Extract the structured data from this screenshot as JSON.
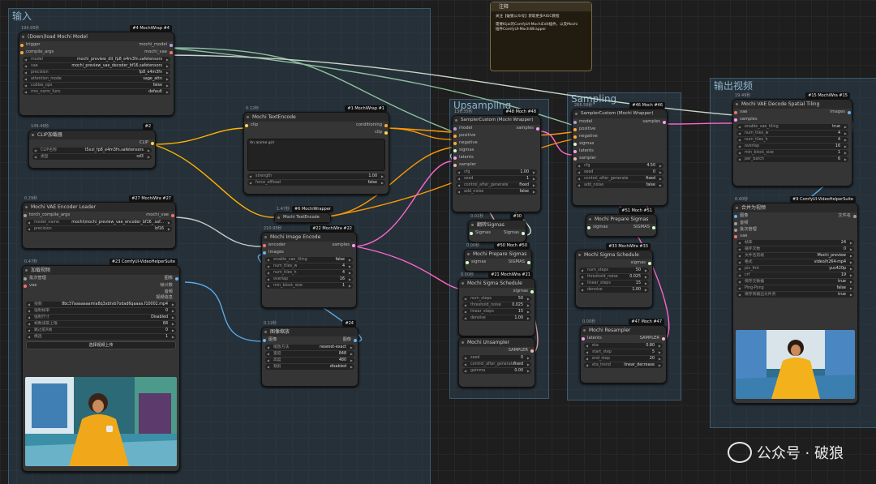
{
  "groups": {
    "input": "输入",
    "sampling1": "Upsampling",
    "sampling2": "Sampling",
    "output": "输出视频"
  },
  "note": {
    "title": "注释",
    "line1": "关注【破狼公众号】获取更多AIGC教程",
    "line2": "需要Kijai的ComfyUI-MochiEdit插件，以及Mochi",
    "line3": "插件ComfyUI-MochiWrapper"
  },
  "download_model": {
    "time": "194.95秒",
    "badge": "#4 MochiWrap  #4",
    "title": "(Down)load Mochi Model",
    "in1": "trigger",
    "in2": "compile_args",
    "out1": "mochi_model",
    "out2": "mochi_vae",
    "w": [
      {
        "k": "model",
        "v": "mochi_preview_dit_fp8_e4m3fn.safetensors"
      },
      {
        "k": "vae",
        "v": "mochi_preview_vae_decoder_bf16.safetensors"
      },
      {
        "k": "precision",
        "v": "fp8_e4m3fn"
      },
      {
        "k": "attention_mode",
        "v": "sage_attn"
      },
      {
        "k": "cublas_ops",
        "v": "false"
      },
      {
        "k": "rms_norm_func",
        "v": "default"
      }
    ]
  },
  "clip_loader": {
    "time": "149.46秒",
    "badge": "#2",
    "title": "CLIP加载器",
    "out1": "CLIP",
    "w": [
      {
        "k": "CLIP名称",
        "v": "t5xxl_fp8_e4m3fn.safetensors"
      },
      {
        "k": "类型",
        "v": "sd3"
      }
    ]
  },
  "text_encode": {
    "time": "0.12秒",
    "badge": "#1 MochiWrap  #1",
    "title": "Mochi TextEncode",
    "in1": "clip",
    "out1": "conditioning",
    "out2": "clip",
    "text": "An anime girl",
    "w": [
      {
        "k": "strength",
        "v": "1.00"
      },
      {
        "k": "force_offload",
        "v": "false"
      }
    ]
  },
  "vae_encoder_loader": {
    "time": "0.29秒",
    "badge": "#27 MochiWra  #27",
    "title": "Mochi VAE Encoder Loader",
    "in1": "torch_compile_args",
    "out1": "mochi_vae",
    "w": [
      {
        "k": "model_name",
        "v": "mochi\\mochi_preview_vae_encoder_bf16_.saf..."
      },
      {
        "k": "precision",
        "v": "bf16"
      }
    ]
  },
  "load_video": {
    "time": "0.47秒",
    "badge": "#23 ComfyUI-VideoHelperSuite",
    "title": "加载视频",
    "in1": "批次管理",
    "in2": "vae",
    "outs": [
      "图像",
      "帧计数",
      "音频",
      "视频信息"
    ],
    "w": [
      {
        "k": "视频",
        "v": "8bc37aaaaaaamia8q3xbtvb7odad6qaaaa.f10002.mp4"
      },
      {
        "k": "强制帧率",
        "v": "0"
      },
      {
        "k": "强制尺寸",
        "v": "Disabled"
      },
      {
        "k": "帧数读取上限",
        "v": "68"
      },
      {
        "k": "跳过前X帧",
        "v": "0"
      },
      {
        "k": "模选",
        "v": "1"
      }
    ],
    "button": "选择视频上传"
  },
  "text_encode2": {
    "time": "1.47秒",
    "badge": "#6 MochiWrapper",
    "title": "Mochi TextEncode"
  },
  "image_encode": {
    "time": "210.95秒",
    "badge": "#22 MochiWra  #22",
    "title": "Mochi Image Encode",
    "in1": "encoder",
    "in2": "images",
    "out1": "samples",
    "w": [
      {
        "k": "enable_vae_tiling",
        "v": "false"
      },
      {
        "k": "num_tiles_w",
        "v": "4"
      },
      {
        "k": "num_tiles_h",
        "v": "4"
      },
      {
        "k": "overlap",
        "v": "16"
      },
      {
        "k": "min_block_size",
        "v": "1"
      }
    ]
  },
  "image_scale": {
    "time": "0.12秒",
    "badge": "#24",
    "title": "图像缩放",
    "in1": "图像",
    "out1": "图像",
    "w": [
      {
        "k": "缩放方法",
        "v": "nearest-exact"
      },
      {
        "k": "宽度",
        "v": "848"
      },
      {
        "k": "高度",
        "v": "480"
      },
      {
        "k": "裁剪",
        "v": "disabled"
      }
    ]
  },
  "sampler_custom1": {
    "time": "136.35秒",
    "badge": "#48 Moch  #48",
    "title": "SamplerCustom (Mochi Wrapper)",
    "ins": [
      "model",
      "positive",
      "negative",
      "sigmas",
      "latents",
      "sampler"
    ],
    "out1": "samples",
    "w": [
      {
        "k": "cfg",
        "v": "1.00"
      },
      {
        "k": "seed",
        "v": "1"
      },
      {
        "k": "control_after_generate",
        "v": "fixed"
      },
      {
        "k": "add_noise",
        "v": "false"
      }
    ]
  },
  "flip_sigmas": {
    "time": "0.01秒",
    "badge": "#30",
    "title": "翻转Sigmas",
    "in1": "Sigmas",
    "out1": "Sigmas"
  },
  "prepare_sigmas1": {
    "time": "0.00秒",
    "badge": "#50 Moch  #50",
    "title": "Mochi Prepare Sigmas",
    "in1": "sigmas",
    "out1": "SIGMAS"
  },
  "sigma_schedule1": {
    "time": "0.00秒",
    "badge": "#21 MochiWra  #21",
    "title": "Mochi Sigma Schedule",
    "out1": "sigmas",
    "w": [
      {
        "k": "num_steps",
        "v": "50"
      },
      {
        "k": "threshold_noise",
        "v": "0.025"
      },
      {
        "k": "linear_steps",
        "v": "15"
      },
      {
        "k": "denoise",
        "v": "1.00"
      }
    ]
  },
  "unsampler": {
    "title": "Mochi Unsampler",
    "out1": "SAMPLER",
    "w": [
      {
        "k": "seed",
        "v": "0"
      },
      {
        "k": "control_after_generate",
        "v": "fixed"
      },
      {
        "k": "gamma",
        "v": "0.00"
      }
    ]
  },
  "sampler_custom2": {
    "time": "266.56秒",
    "badge": "#46 Moch  #46",
    "title": "SamplerCustom (Mochi Wrapper)",
    "ins": [
      "model",
      "positive",
      "negative",
      "sigmas",
      "latents",
      "sampler"
    ],
    "out1": "samples",
    "w": [
      {
        "k": "cfg",
        "v": "4.50"
      },
      {
        "k": "seed",
        "v": "0"
      },
      {
        "k": "control_after_generate",
        "v": "fixed"
      },
      {
        "k": "add_noise",
        "v": "false"
      }
    ]
  },
  "prepare_sigmas2": {
    "badge": "#51 Moch  #51",
    "title": "Mochi Prepare Sigmas",
    "in1": "sigmas",
    "out1": "SIGMAS"
  },
  "sigma_schedule2": {
    "badge": "#33 MochiWra  #33",
    "title": "Mochi Sigma Schedule",
    "out1": "sigmas",
    "w": [
      {
        "k": "num_steps",
        "v": "50"
      },
      {
        "k": "threshold_noise",
        "v": "0.025"
      },
      {
        "k": "linear_steps",
        "v": "15"
      },
      {
        "k": "denoise",
        "v": "1.00"
      }
    ]
  },
  "resampler": {
    "time": "0.00秒",
    "badge": "#47 Moch  #47",
    "title": "Mochi Resampler",
    "in1": "latents",
    "out1": "SAMPLER",
    "w": [
      {
        "k": "eta",
        "v": "0.80"
      },
      {
        "k": "start_step",
        "v": "5"
      },
      {
        "k": "end_step",
        "v": "20"
      },
      {
        "k": "eta_trend",
        "v": "linear_decrease"
      }
    ]
  },
  "vae_decode": {
    "time": "19.49秒",
    "badge": "#15 MochiWra  #15",
    "title": "Mochi VAE Decode Spatial Tiling",
    "in1": "vae",
    "in2": "samples",
    "out1": "images",
    "w": [
      {
        "k": "enable_vae_tiling",
        "v": "true"
      },
      {
        "k": "num_tiles_w",
        "v": "4"
      },
      {
        "k": "num_tiles_h",
        "v": "4"
      },
      {
        "k": "overlap",
        "v": "16"
      },
      {
        "k": "min_block_size",
        "v": "1"
      },
      {
        "k": "per_batch",
        "v": "6"
      }
    ]
  },
  "video_combine": {
    "time": "0.40秒",
    "badge": "#9 ComfyUI-VideoHelperSuite",
    "title": "合并为视频",
    "ins": [
      "图像",
      "音频",
      "批次管理",
      "vae"
    ],
    "out1": "文件名",
    "w": [
      {
        "k": "帧率",
        "v": "24"
      },
      {
        "k": "循环次数",
        "v": "0"
      },
      {
        "k": "文件名前缀",
        "v": "Mochi_preview"
      },
      {
        "k": "格式",
        "v": "video/h264-mp4"
      },
      {
        "k": "pix_fmt",
        "v": "yuv420p"
      },
      {
        "k": "crf",
        "v": "19"
      },
      {
        "k": "保存元数据",
        "v": "true"
      },
      {
        "k": "Ping-Pong",
        "v": "false"
      },
      {
        "k": "保存到输出文件夹",
        "v": "true"
      }
    ]
  },
  "watermark": "公众号 · 破狼",
  "colors": {
    "model": "#b39ddb",
    "clip": "#ffd54f",
    "vae": "#ff6e6e",
    "latent": "#ff9cf9",
    "image": "#64b5f6",
    "cond": "#ffa931",
    "sigmas": "#cdffcd",
    "sampler": "#ecb4b4",
    "generic": "#9e9e9e"
  }
}
